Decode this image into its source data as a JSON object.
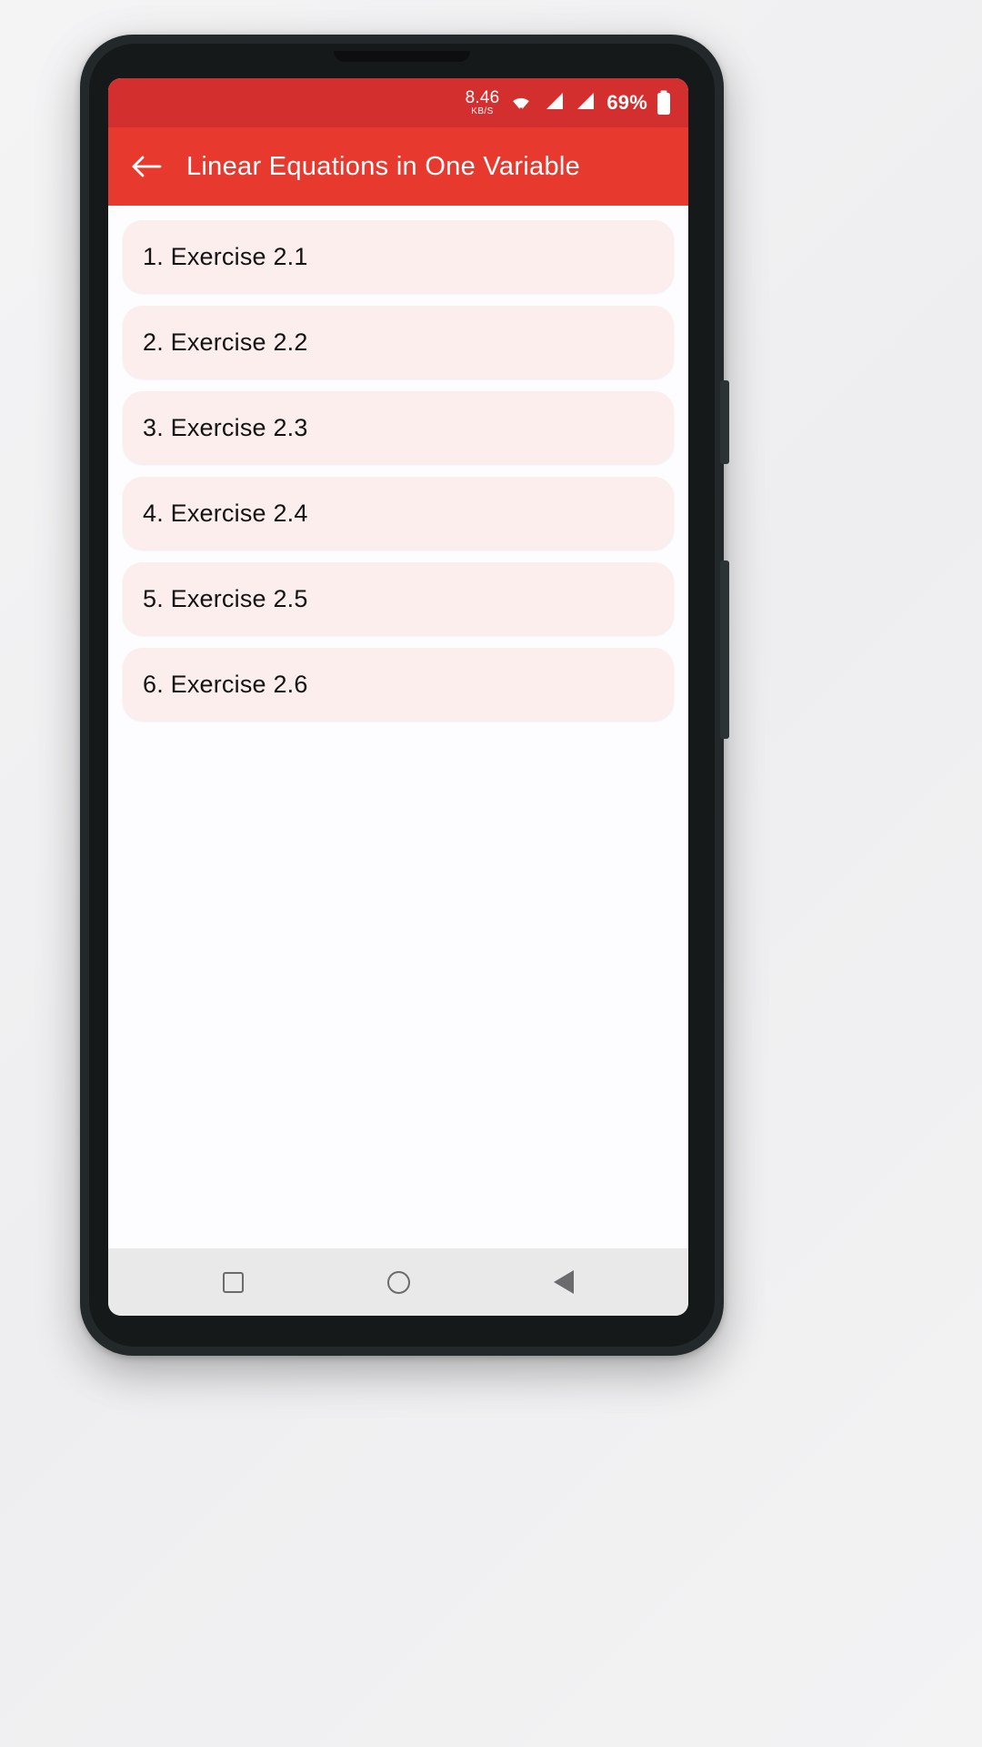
{
  "status_bar": {
    "network_speed_value": "8.46",
    "network_speed_unit": "KB/S",
    "wifi_icon": "wifi-icon",
    "signal_icon_1": "signal-bars-icon",
    "signal_icon_2": "signal-bars-icon",
    "battery_percent": "69%",
    "battery_icon": "battery-icon",
    "background_color": "#d32f2e"
  },
  "app_bar": {
    "back_icon": "back-arrow-icon",
    "title": "Linear Equations in One Variable",
    "background_color": "#e8392f",
    "text_color": "#ffffff"
  },
  "list": {
    "card_color": "#fbeeec",
    "items": [
      {
        "label": "1. Exercise 2.1"
      },
      {
        "label": "2. Exercise 2.2"
      },
      {
        "label": "3. Exercise 2.3"
      },
      {
        "label": "4. Exercise 2.4"
      },
      {
        "label": "5. Exercise 2.5"
      },
      {
        "label": "6. Exercise 2.6"
      }
    ]
  },
  "nav_bar": {
    "recents_icon": "square-recents-icon",
    "home_icon": "circle-home-icon",
    "back_icon": "triangle-back-icon",
    "background_color": "#e9e9ea"
  }
}
